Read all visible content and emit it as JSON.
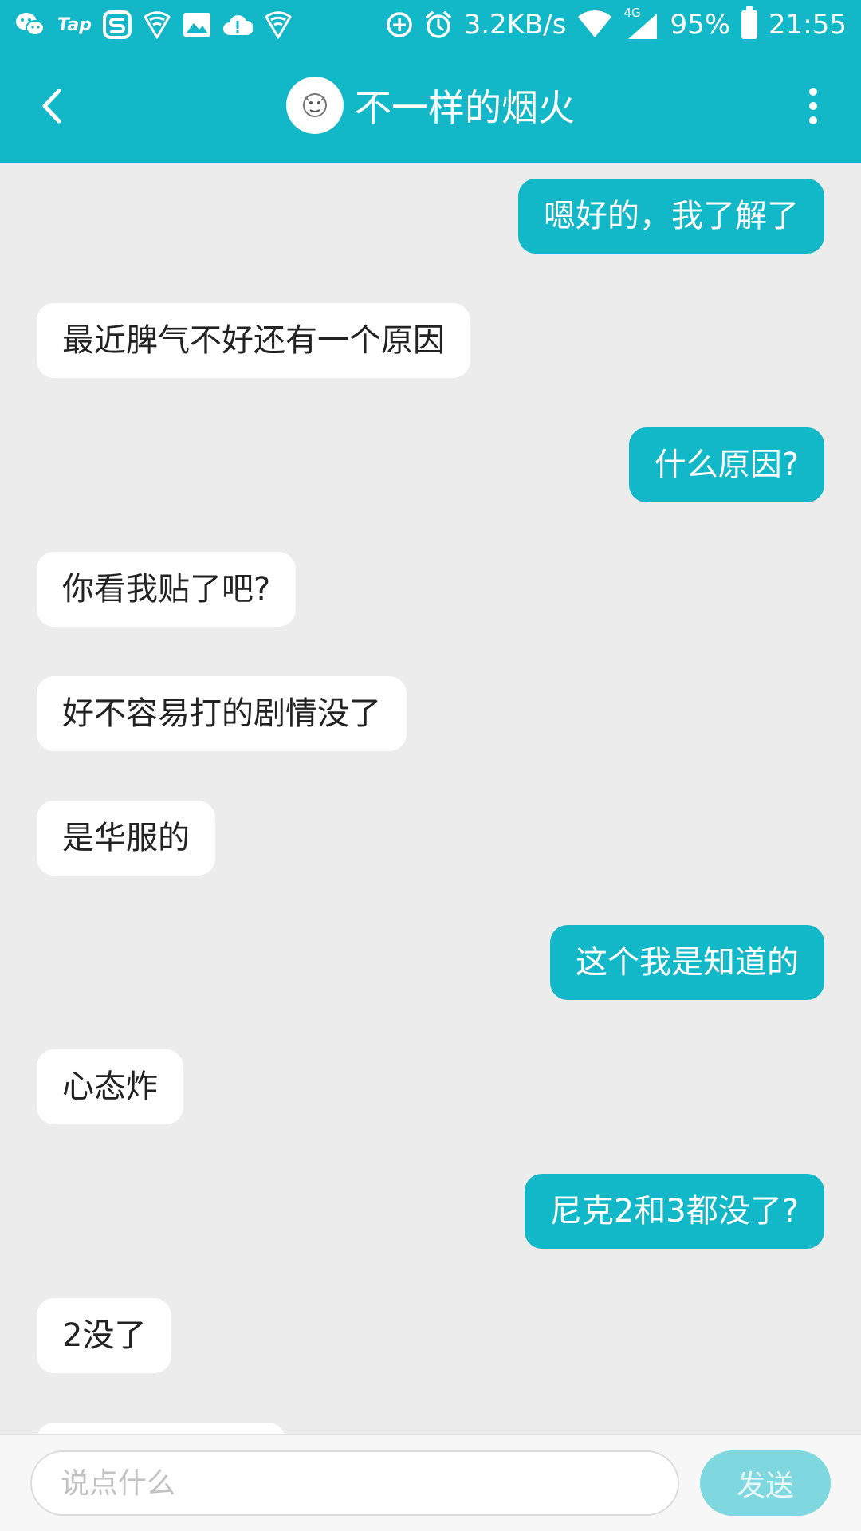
{
  "status_bar": {
    "left_icons": [
      "wechat-icon",
      "tap-icon",
      "s-app-icon",
      "wifi-shield-icon",
      "image-icon",
      "cloud-alert-icon",
      "wifi-shield-icon"
    ],
    "tap_label": "Tap",
    "net_speed": "3.2KB/s",
    "network_type": "4G",
    "battery": "95%",
    "time": "21:55"
  },
  "header": {
    "title": "不一样的烟火",
    "back_icon": "chevron-left-icon",
    "more_icon": "more-vertical-icon"
  },
  "messages": [
    {
      "side": "out",
      "text": "嗯好的，我了解了"
    },
    {
      "side": "in",
      "text": "最近脾气不好还有一个原因"
    },
    {
      "side": "out",
      "text": "什么原因?"
    },
    {
      "side": "in",
      "text": "你看我贴了吧?"
    },
    {
      "side": "in",
      "text": "好不容易打的剧情没了"
    },
    {
      "side": "in",
      "text": "是华服的"
    },
    {
      "side": "out",
      "text": "这个我是知道的"
    },
    {
      "side": "in",
      "text": "心态炸"
    },
    {
      "side": "out",
      "text": "尼克2和3都没了?"
    },
    {
      "side": "in",
      "text": "2没了"
    }
  ],
  "input": {
    "placeholder": "说点什么",
    "value": "",
    "send_label": "发送"
  },
  "colors": {
    "accent": "#12b8c8",
    "send_disabled": "#7fd7df",
    "background": "#ececec"
  }
}
